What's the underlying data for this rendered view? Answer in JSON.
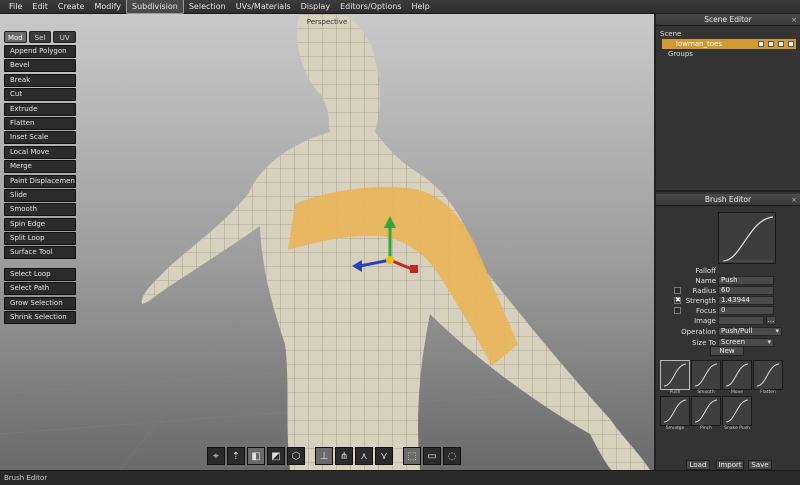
{
  "menu": [
    "File",
    "Edit",
    "Create",
    "Modify",
    "Subdivision",
    "Selection",
    "UVs/Materials",
    "Display",
    "Editors/Options",
    "Help"
  ],
  "menu_active": "Subdivision",
  "viewport": {
    "label": "Perspective"
  },
  "toolbox": {
    "tabs": [
      "Mod",
      "Sel",
      "UV"
    ],
    "active_tab": "Mod",
    "tools": [
      "Append Polygon",
      "Bevel",
      "Break",
      "Cut",
      "Extrude",
      "Flatten",
      "Inset Scale",
      "Local Move",
      "Merge",
      "Paint Displacement",
      "Slide",
      "Smooth",
      "Spin Edge",
      "Split Loop",
      "Surface Tool"
    ],
    "selection_tools": [
      "Select Loop",
      "Select Path",
      "Grow Selection",
      "Shrink Selection"
    ]
  },
  "bottom_tools": [
    "snap-icon",
    "move-icon",
    "cube-solid-icon",
    "cube-shaded-icon",
    "cube-wire-icon",
    "axis-icon",
    "axis-local-icon",
    "axis-screen-icon",
    "axis-object-icon",
    "select-rect-icon",
    "select-lasso-icon",
    "select-loop-icon"
  ],
  "scene_editor": {
    "title": "Scene Editor",
    "root": "Scene",
    "selected_object": "lowman_toes",
    "groups": "Groups"
  },
  "brush_editor": {
    "title": "Brush Editor",
    "falloff_label": "Falloff",
    "name_label": "Name",
    "name_value": "Push",
    "radius_label": "Radius",
    "radius_value": "60",
    "strength_label": "Strength",
    "strength_value": "1.43944",
    "strength_checked": "✖",
    "focus_label": "Focus",
    "focus_value": "0",
    "image_label": "Image",
    "image_button": "...",
    "operation_label": "Operation",
    "operation_value": "Push/Pull",
    "size_to_label": "Size To",
    "size_to_value": "Screen",
    "new_button": "New",
    "presets": [
      "Push",
      "Smooth",
      "Move",
      "Flatten",
      "Smudge",
      "Pinch",
      "Snake Push"
    ],
    "load_button": "Load",
    "import_button": "Import",
    "save_button": "Save"
  },
  "statusbar": "Brush Editor",
  "colors": {
    "selection": "#e8b45a",
    "accent": "#d29a35",
    "mesh": "#d8d1bd"
  }
}
